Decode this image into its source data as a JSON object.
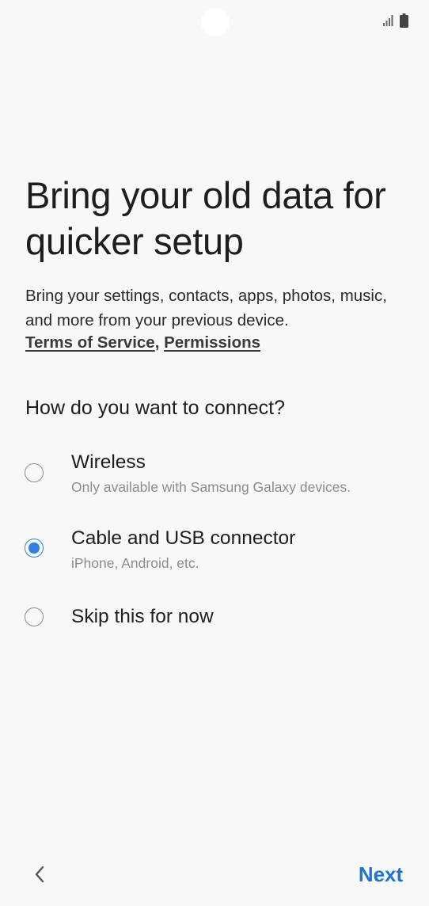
{
  "status_bar": {
    "icons": [
      "signal-icon",
      "battery-icon"
    ]
  },
  "header": {
    "title": "Bring your old data for quicker setup",
    "description": "Bring your settings, contacts, apps, photos, music, and more from your previous device.",
    "links": {
      "terms": "Terms of Service",
      "separator": ",",
      "permissions": "Permissions"
    }
  },
  "connect": {
    "question": "How do you want to connect?",
    "selected": "Cable and USB connector",
    "options": [
      {
        "label": "Wireless",
        "sublabel": "Only available with Samsung Galaxy devices.",
        "selected": false
      },
      {
        "label": "Cable and USB connector",
        "sublabel": "iPhone, Android, etc.",
        "selected": true
      },
      {
        "label": "Skip this for now",
        "sublabel": "",
        "selected": false
      }
    ]
  },
  "footer": {
    "back_icon": "chevron-left-icon",
    "next_label": "Next"
  },
  "colors": {
    "background": "#f8f8f8",
    "accent": "#1d74d6",
    "radio_selected": "#2f7fe6"
  }
}
